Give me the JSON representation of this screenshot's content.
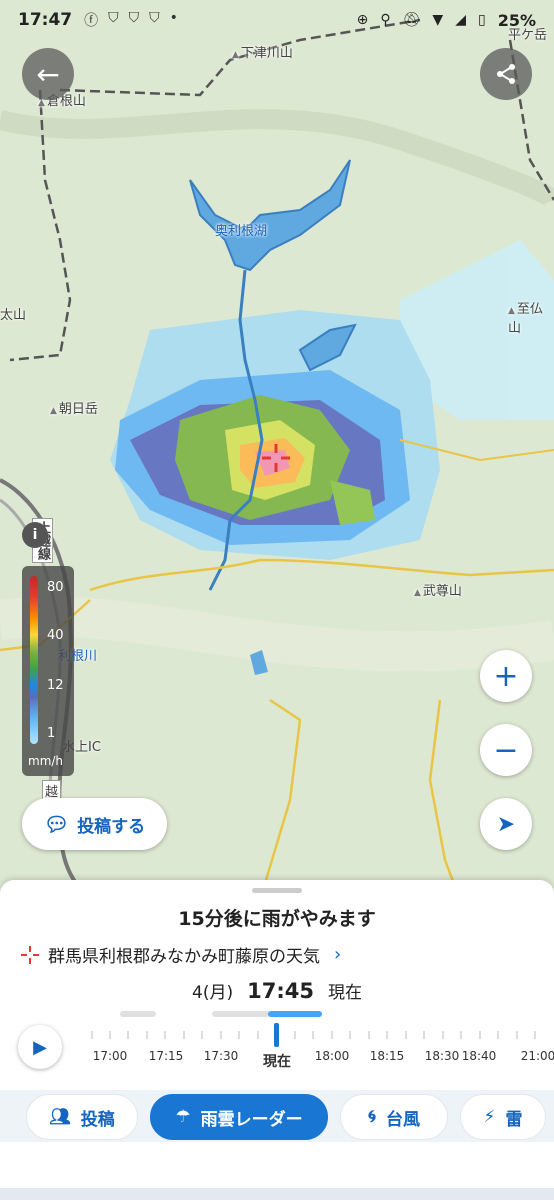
{
  "status_bar": {
    "time": "17:47",
    "battery": "25%"
  },
  "map": {
    "labels": {
      "shimotsugawayama": "下津川山",
      "kurasuyama": "倉根山",
      "okutone_lake": "奥利根湖",
      "taiyama": "太山",
      "shibutsusan": "至仏山",
      "asahidake": "朝日岳",
      "jouetsu_line": "上越線",
      "tonegawa": "利根川",
      "minakami_ic": "水上IC",
      "buson": "武尊山",
      "etsu": "越",
      "hiragatake": "平ケ岳"
    }
  },
  "legend": {
    "ticks": [
      "80",
      "40",
      "12",
      "1"
    ],
    "unit": "mm/h"
  },
  "post_button_label": "投稿する",
  "sheet": {
    "message": "15分後に雨がやみます",
    "location": "群馬県利根郡みなかみ町藤原の天気",
    "date": "4(月)",
    "time": "17:45",
    "now_suffix": "現在",
    "timeline_labels": [
      "17:00",
      "17:15",
      "17:30",
      "現在",
      "18:00",
      "18:15",
      "18:30",
      "18:40",
      "21:00"
    ]
  },
  "nav": {
    "post": "投稿",
    "radar": "雨雲レーダー",
    "typhoon": "台風",
    "thunder": "雷"
  },
  "colors": {
    "accent": "#1976d2"
  }
}
